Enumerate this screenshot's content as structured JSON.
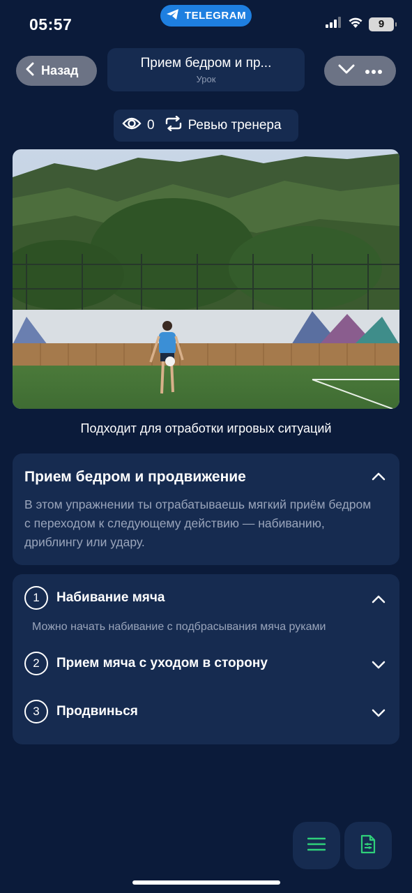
{
  "status_bar": {
    "time": "05:57",
    "telegram_label": "TELEGRAM",
    "battery_level": "9"
  },
  "header": {
    "back_label": "Назад",
    "title": "Прием бедром и пр...",
    "subtitle": "Урок"
  },
  "stats": {
    "views_count": "0",
    "review_label": "Ревью тренера"
  },
  "media": {
    "caption": "Подходит для отработки игровых ситуаций"
  },
  "description": {
    "title": "Прием бедром и продвижение",
    "text": "В этом упражнении ты отрабатываешь мягкий приём бедром с переходом к следующему действию — набиванию, дриблингу или удару."
  },
  "steps": [
    {
      "number": "1",
      "label": "Набивание мяча",
      "note": "Можно начать набивание с подбрасывания мяча руками",
      "expanded": true
    },
    {
      "number": "2",
      "label": "Прием мяча с уходом в сторону",
      "expanded": false
    },
    {
      "number": "3",
      "label": "Продвинься",
      "expanded": false
    }
  ],
  "colors": {
    "background": "#0b1b3a",
    "card": "#162b50",
    "accent_green": "#2fd07a",
    "telegram_blue": "#1e7fe0"
  },
  "icons": [
    "telegram-icon",
    "eye-icon",
    "repeat-icon",
    "chevron-left-icon",
    "chevron-down-icon",
    "more-icon",
    "chevron-up-icon",
    "list-icon",
    "document-icon"
  ]
}
